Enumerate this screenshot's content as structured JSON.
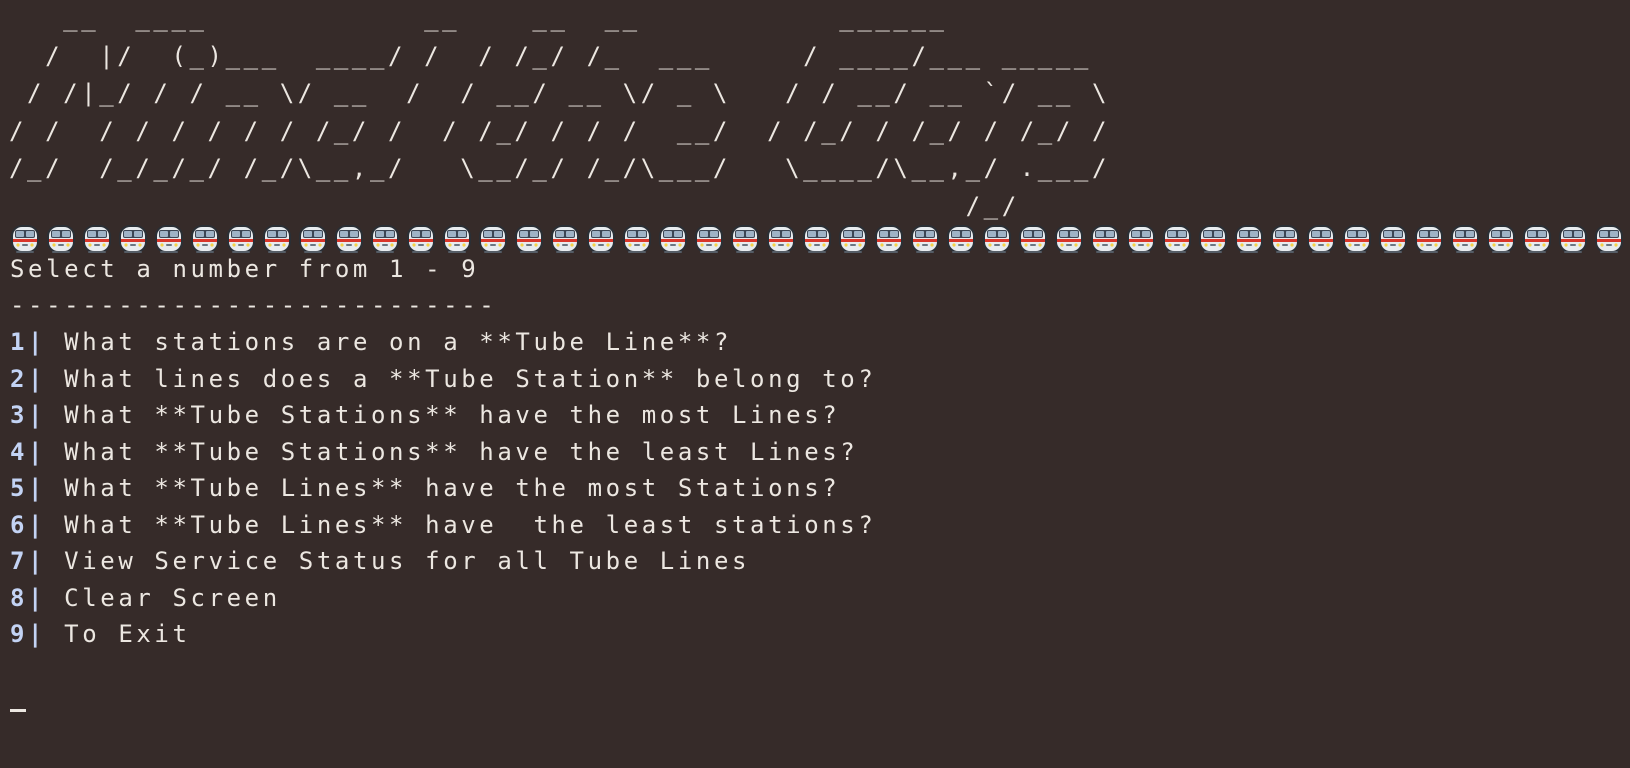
{
  "banner": {
    "ascii_art": "   __  ____            __    __  __           ______\n  /  |/  (_)___  ____/ /  / /_/ /_  ___     / ____/___ _____\n / /|_/ / / __ \\/ __  /  / __/ __ \\/ _ \\   / / __/ __ `/ __ \\\n/ /  / / / / / / /_/ /  / /_/ / / /  __/  / /_/ / /_/ / /_/ /\n/_/  /_/_/_/ /_/\\__,_/   \\__/_/ /_/\\___/   \\____/\\__,_/ .___/\n                                                     /_/"
  },
  "train_divider": {
    "icon": "metro-train-icon",
    "count": 46
  },
  "prompt": "Select a number from 1 - 9",
  "separator": "---------------------------",
  "menu": {
    "items": [
      {
        "num": "1|",
        "label": "What stations are on a **Tube Line**?"
      },
      {
        "num": "2|",
        "label": "What lines does a **Tube Station** belong to?"
      },
      {
        "num": "3|",
        "label": "What **Tube Stations** have the most Lines?"
      },
      {
        "num": "4|",
        "label": "What **Tube Stations** have the least Lines?"
      },
      {
        "num": "5|",
        "label": "What **Tube Lines** have the most Stations?"
      },
      {
        "num": "6|",
        "label": "What **Tube Lines** have  the least stations?"
      },
      {
        "num": "7|",
        "label": "View Service Status for all Tube Lines"
      },
      {
        "num": "8|",
        "label": "Clear Screen"
      },
      {
        "num": "9|",
        "label": "To Exit"
      }
    ]
  },
  "colors": {
    "background": "#362b29",
    "text": "#ece7e1",
    "menu_number": "#c3d3f4"
  }
}
